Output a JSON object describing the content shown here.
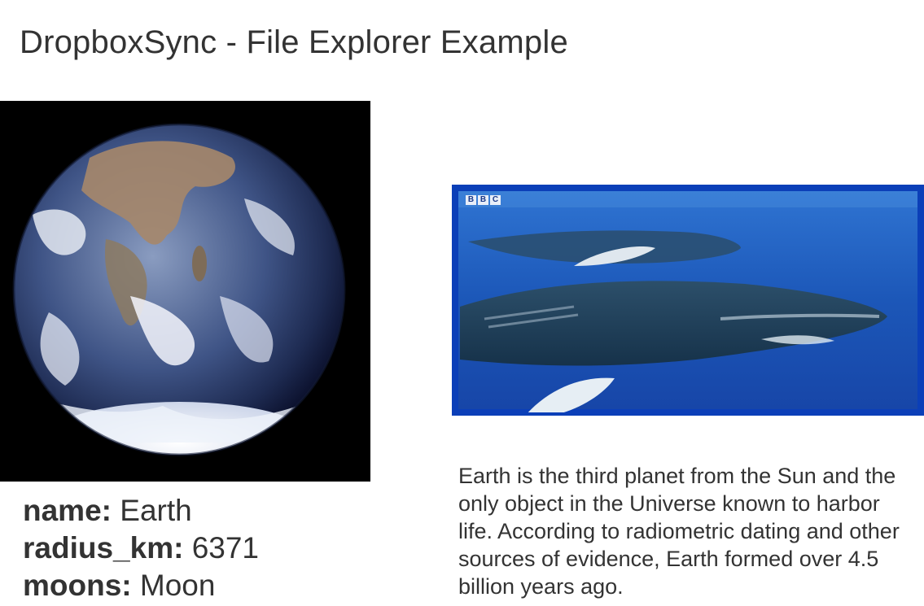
{
  "page": {
    "title": "DropboxSync - File Explorer Example"
  },
  "properties": [
    {
      "key": "name:",
      "value": "Earth"
    },
    {
      "key": "radius_km:",
      "value": "6371"
    },
    {
      "key": "moons:",
      "value": "Moon"
    }
  ],
  "video": {
    "watermark": [
      "B",
      "B",
      "C"
    ]
  },
  "description": "Earth is the third planet from the Sun and the only object in the Universe known to harbor life. According to radiometric dating and other sources of evidence, Earth formed over 4.5 billion years ago.",
  "colors": {
    "text": "#333333",
    "video_border": "#0b3fb8",
    "background": "#ffffff"
  }
}
